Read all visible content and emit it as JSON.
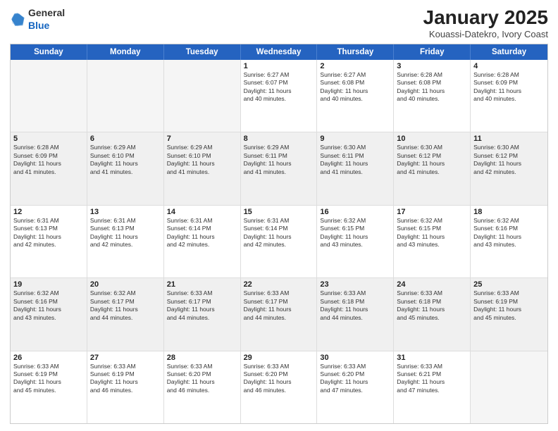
{
  "logo": {
    "general": "General",
    "blue": "Blue"
  },
  "title": "January 2025",
  "subtitle": "Kouassi-Datekro, Ivory Coast",
  "header_days": [
    "Sunday",
    "Monday",
    "Tuesday",
    "Wednesday",
    "Thursday",
    "Friday",
    "Saturday"
  ],
  "weeks": [
    [
      {
        "day": "",
        "info": "",
        "empty": true
      },
      {
        "day": "",
        "info": "",
        "empty": true
      },
      {
        "day": "",
        "info": "",
        "empty": true
      },
      {
        "day": "1",
        "info": "Sunrise: 6:27 AM\nSunset: 6:07 PM\nDaylight: 11 hours\nand 40 minutes."
      },
      {
        "day": "2",
        "info": "Sunrise: 6:27 AM\nSunset: 6:08 PM\nDaylight: 11 hours\nand 40 minutes."
      },
      {
        "day": "3",
        "info": "Sunrise: 6:28 AM\nSunset: 6:08 PM\nDaylight: 11 hours\nand 40 minutes."
      },
      {
        "day": "4",
        "info": "Sunrise: 6:28 AM\nSunset: 6:09 PM\nDaylight: 11 hours\nand 40 minutes."
      }
    ],
    [
      {
        "day": "5",
        "info": "Sunrise: 6:28 AM\nSunset: 6:09 PM\nDaylight: 11 hours\nand 41 minutes."
      },
      {
        "day": "6",
        "info": "Sunrise: 6:29 AM\nSunset: 6:10 PM\nDaylight: 11 hours\nand 41 minutes."
      },
      {
        "day": "7",
        "info": "Sunrise: 6:29 AM\nSunset: 6:10 PM\nDaylight: 11 hours\nand 41 minutes."
      },
      {
        "day": "8",
        "info": "Sunrise: 6:29 AM\nSunset: 6:11 PM\nDaylight: 11 hours\nand 41 minutes."
      },
      {
        "day": "9",
        "info": "Sunrise: 6:30 AM\nSunset: 6:11 PM\nDaylight: 11 hours\nand 41 minutes."
      },
      {
        "day": "10",
        "info": "Sunrise: 6:30 AM\nSunset: 6:12 PM\nDaylight: 11 hours\nand 41 minutes."
      },
      {
        "day": "11",
        "info": "Sunrise: 6:30 AM\nSunset: 6:12 PM\nDaylight: 11 hours\nand 42 minutes."
      }
    ],
    [
      {
        "day": "12",
        "info": "Sunrise: 6:31 AM\nSunset: 6:13 PM\nDaylight: 11 hours\nand 42 minutes."
      },
      {
        "day": "13",
        "info": "Sunrise: 6:31 AM\nSunset: 6:13 PM\nDaylight: 11 hours\nand 42 minutes."
      },
      {
        "day": "14",
        "info": "Sunrise: 6:31 AM\nSunset: 6:14 PM\nDaylight: 11 hours\nand 42 minutes."
      },
      {
        "day": "15",
        "info": "Sunrise: 6:31 AM\nSunset: 6:14 PM\nDaylight: 11 hours\nand 42 minutes."
      },
      {
        "day": "16",
        "info": "Sunrise: 6:32 AM\nSunset: 6:15 PM\nDaylight: 11 hours\nand 43 minutes."
      },
      {
        "day": "17",
        "info": "Sunrise: 6:32 AM\nSunset: 6:15 PM\nDaylight: 11 hours\nand 43 minutes."
      },
      {
        "day": "18",
        "info": "Sunrise: 6:32 AM\nSunset: 6:16 PM\nDaylight: 11 hours\nand 43 minutes."
      }
    ],
    [
      {
        "day": "19",
        "info": "Sunrise: 6:32 AM\nSunset: 6:16 PM\nDaylight: 11 hours\nand 43 minutes."
      },
      {
        "day": "20",
        "info": "Sunrise: 6:32 AM\nSunset: 6:17 PM\nDaylight: 11 hours\nand 44 minutes."
      },
      {
        "day": "21",
        "info": "Sunrise: 6:33 AM\nSunset: 6:17 PM\nDaylight: 11 hours\nand 44 minutes."
      },
      {
        "day": "22",
        "info": "Sunrise: 6:33 AM\nSunset: 6:17 PM\nDaylight: 11 hours\nand 44 minutes."
      },
      {
        "day": "23",
        "info": "Sunrise: 6:33 AM\nSunset: 6:18 PM\nDaylight: 11 hours\nand 44 minutes."
      },
      {
        "day": "24",
        "info": "Sunrise: 6:33 AM\nSunset: 6:18 PM\nDaylight: 11 hours\nand 45 minutes."
      },
      {
        "day": "25",
        "info": "Sunrise: 6:33 AM\nSunset: 6:19 PM\nDaylight: 11 hours\nand 45 minutes."
      }
    ],
    [
      {
        "day": "26",
        "info": "Sunrise: 6:33 AM\nSunset: 6:19 PM\nDaylight: 11 hours\nand 45 minutes."
      },
      {
        "day": "27",
        "info": "Sunrise: 6:33 AM\nSunset: 6:19 PM\nDaylight: 11 hours\nand 46 minutes."
      },
      {
        "day": "28",
        "info": "Sunrise: 6:33 AM\nSunset: 6:20 PM\nDaylight: 11 hours\nand 46 minutes."
      },
      {
        "day": "29",
        "info": "Sunrise: 6:33 AM\nSunset: 6:20 PM\nDaylight: 11 hours\nand 46 minutes."
      },
      {
        "day": "30",
        "info": "Sunrise: 6:33 AM\nSunset: 6:20 PM\nDaylight: 11 hours\nand 47 minutes."
      },
      {
        "day": "31",
        "info": "Sunrise: 6:33 AM\nSunset: 6:21 PM\nDaylight: 11 hours\nand 47 minutes."
      },
      {
        "day": "",
        "info": "",
        "empty": true
      }
    ]
  ]
}
